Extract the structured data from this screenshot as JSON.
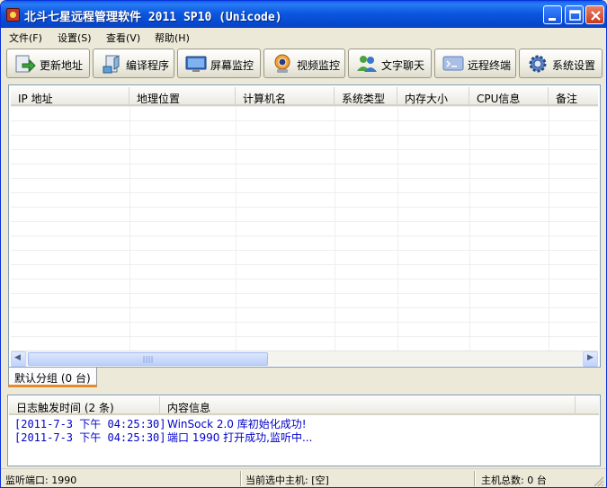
{
  "window": {
    "title": "北斗七星远程管理软件 2011 SP10 (Unicode)"
  },
  "menu": [
    {
      "label": "文件(F)"
    },
    {
      "label": "设置(S)"
    },
    {
      "label": "查看(V)"
    },
    {
      "label": "帮助(H)"
    }
  ],
  "toolbar": [
    {
      "label": "更新地址",
      "icon": "update-address-icon"
    },
    {
      "label": "编译程序",
      "icon": "compile-program-icon"
    },
    {
      "label": "屏幕监控",
      "icon": "screen-monitor-icon"
    },
    {
      "label": "视频监控",
      "icon": "webcam-icon"
    },
    {
      "label": "文字聊天",
      "icon": "chat-users-icon"
    },
    {
      "label": "远程终端",
      "icon": "remote-terminal-icon"
    },
    {
      "label": "系统设置",
      "icon": "settings-gear-icon"
    }
  ],
  "host_list": {
    "columns": [
      "IP 地址",
      "地理位置",
      "计算机名",
      "系统类型",
      "内存大小",
      "CPU信息",
      "备注"
    ],
    "scroll_arrow_left": "◀",
    "scroll_arrow_right": "▶"
  },
  "group_tab": {
    "label": "默认分组 (0 台)"
  },
  "log": {
    "columns": [
      "日志触发时间 (2 条)",
      "内容信息"
    ],
    "rows": [
      {
        "time": "[2011-7-3 下午 04:25:30]",
        "message": "WinSock 2.0 库初始化成功!"
      },
      {
        "time": "[2011-7-3 下午 04:25:30]",
        "message": "端口 1990 打开成功,监听中..."
      }
    ]
  },
  "status": {
    "port": "监听端口: 1990",
    "selected": "当前选中主机: [空]",
    "total": "主机总数: 0 台"
  },
  "colors": {
    "titlebar": "#0a5fe8",
    "log_text": "#0000c8",
    "tab_accent": "#e68b2c"
  }
}
